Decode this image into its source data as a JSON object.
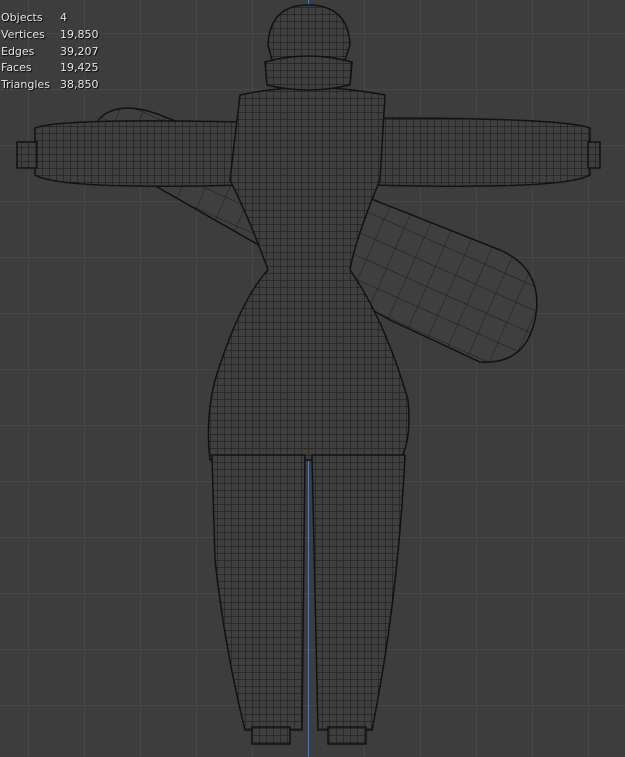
{
  "viewport": {
    "mode": "wireframe",
    "axis_color": "#4f7bb5",
    "background": "#3d3d3d"
  },
  "stats": [
    {
      "label": "Objects",
      "value": "4"
    },
    {
      "label": "Vertices",
      "value": "19,850"
    },
    {
      "label": "Edges",
      "value": "39,207"
    },
    {
      "label": "Faces",
      "value": "19,425"
    },
    {
      "label": "Triangles",
      "value": "38,850"
    }
  ]
}
